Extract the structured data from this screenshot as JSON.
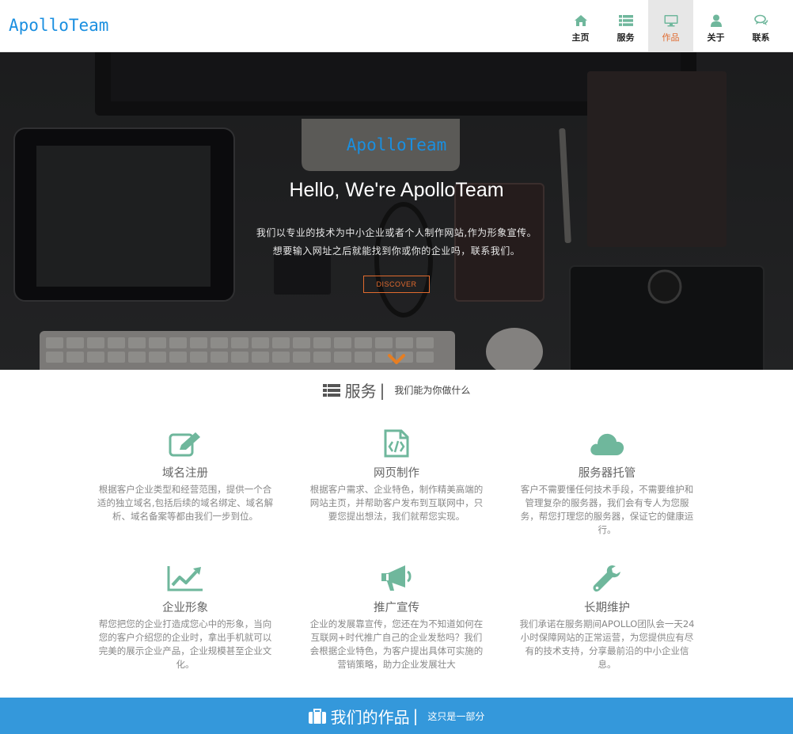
{
  "header": {
    "logo": "ApolloTeam",
    "nav": [
      {
        "label": "主页",
        "icon": "home-icon"
      },
      {
        "label": "服务",
        "icon": "list-icon"
      },
      {
        "label": "作品",
        "icon": "desktop-icon",
        "active": true
      },
      {
        "label": "关于",
        "icon": "user-icon"
      },
      {
        "label": "联系",
        "icon": "comments-icon"
      }
    ]
  },
  "hero": {
    "brand": "ApolloTeam",
    "title": "Hello, We're ApolloTeam",
    "line1": "我们以专业的技术为中小企业或者个人制作网站,作为形象宣传。",
    "line2": "想要输入网址之后就能找到你或你的企业吗，联系我们。",
    "button": "DISCOVER",
    "scroll_icon": "chevron-down-icon"
  },
  "services": {
    "title": "服务",
    "subtitle": "我们能为你做什么",
    "icon": "list-icon",
    "items": [
      {
        "name": "域名注册",
        "icon": "edit-icon",
        "desc": "根据客户企业类型和经营范围，提供一个合适的独立域名,包括后续的域名绑定、域名解析、域名备案等都由我们一步到位。"
      },
      {
        "name": "网页制作",
        "icon": "code-file-icon",
        "desc": "根据客户需求、企业特色，制作精美高端的网站主页，并帮助客户发布到互联网中，只要您提出想法，我们就帮您实现。"
      },
      {
        "name": "服务器托管",
        "icon": "cloud-icon",
        "desc": "客户不需要懂任何技术手段，不需要维护和管理复杂的服务器，我们会有专人为您服务，帮您打理您的服务器，保证它的健康运行。"
      },
      {
        "name": "企业形象",
        "icon": "line-chart-icon",
        "desc": "帮您把您的企业打造成您心中的形象，当向您的客户介绍您的企业时，拿出手机就可以完美的展示企业产品，企业规模甚至企业文化。"
      },
      {
        "name": "推广宣传",
        "icon": "bullhorn-icon",
        "desc": "企业的发展靠宣传，您还在为不知道如何在互联网+时代推广自己的企业发愁吗？我们会根据企业特色，为客户提出具体可实施的营销策略，助力企业发展壮大"
      },
      {
        "name": "长期维护",
        "icon": "wrench-icon",
        "desc": "我们承诺在服务期间APOLLO团队会一天24小时保障网站的正常运营，为您提供应有尽有的技术支持，分享最前沿的中小企业信息。"
      }
    ]
  },
  "works": {
    "title": "我们的作品",
    "subtitle": "这只是一部分",
    "icon": "briefcase-icon"
  },
  "colors": {
    "accent_blue": "#1a8fe0",
    "accent_orange": "#e06a2e",
    "icon_green": "#6fb79c",
    "band_blue": "#3498db"
  }
}
